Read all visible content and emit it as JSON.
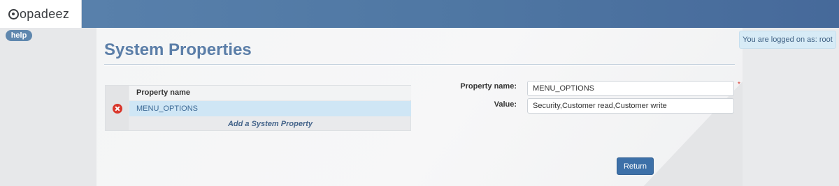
{
  "app": {
    "logo_text": "opadeez",
    "help_label": "help",
    "login_status": "You are logged on as: root"
  },
  "page": {
    "title": "System Properties"
  },
  "properties_table": {
    "column_header": "Property name",
    "rows": [
      {
        "name": "MENU_OPTIONS",
        "delete_icon": "delete-icon",
        "selected": true
      }
    ],
    "add_label": "Add a System Property"
  },
  "form": {
    "property_name_label": "Property name:",
    "property_name_value": "MENU_OPTIONS",
    "value_label": "Value:",
    "value_value": "Security,Customer read,Customer write",
    "required_marker": "*",
    "return_label": "Return"
  },
  "colors": {
    "header_blue": "#4f77a3",
    "title_blue": "#5b7ea8",
    "selected_row": "#cfe6f5",
    "delete_red": "#d9362b",
    "button_blue": "#3d70a8"
  }
}
